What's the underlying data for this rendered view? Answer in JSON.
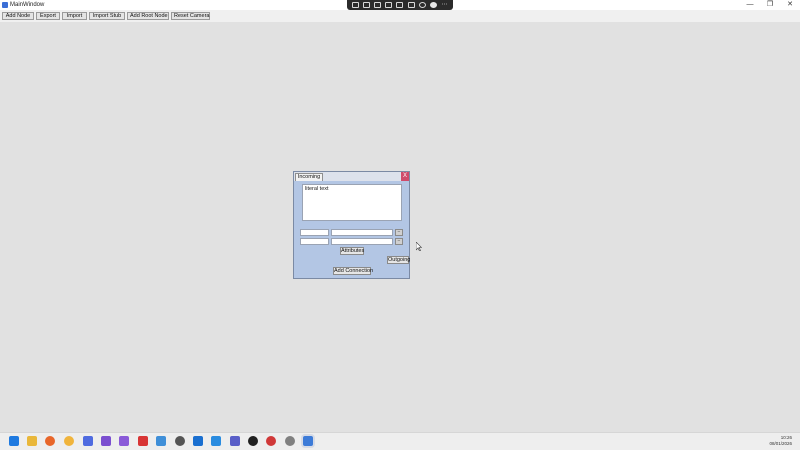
{
  "window": {
    "title": "MainWindow",
    "controls": {
      "minimize": "—",
      "maximize": "❐",
      "close": "✕"
    }
  },
  "toolbar": {
    "buttons": [
      "Add Node",
      "Export",
      "Import",
      "Import Stub",
      "Add Root Node",
      "Reset Camera"
    ]
  },
  "node": {
    "tab_label": "Incoming",
    "close_label": "X",
    "text": "literal text",
    "attributes_label": "Attributes",
    "outgoing_label": "Outgoing",
    "add_connection_label": "Add Connection",
    "remove_label": "−",
    "colors": {
      "panel": "#b3c6e4",
      "close": "#cf4b6b"
    }
  },
  "taskbar": {
    "apps": [
      "start-icon",
      "file-explorer-icon",
      "firefox-icon",
      "chrome-icon",
      "qq-icon",
      "obsidian-icon",
      "visual-studio-icon",
      "zotero-icon",
      "notepad-icon",
      "unity-icon",
      "outlook-icon",
      "vscode-icon",
      "teams-icon",
      "github-icon",
      "app-red-icon",
      "settings-icon",
      "mainwindow-icon"
    ],
    "time": "10:26",
    "date": "08/01/2026"
  }
}
